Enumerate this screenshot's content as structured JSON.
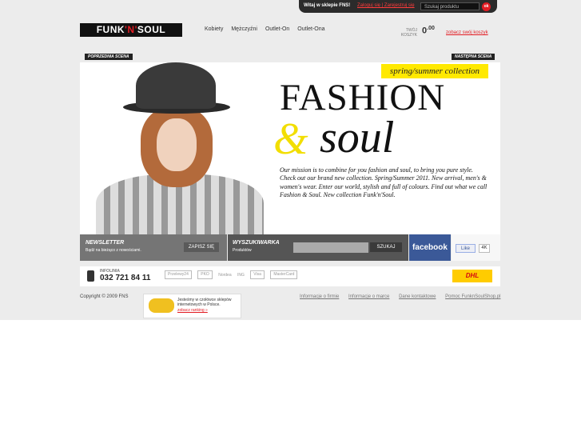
{
  "topbar": {
    "welcome": "Witaj w sklepie FNS!",
    "login": "Zaloguj się | Zarejestruj się",
    "search_placeholder": "Szukaj produktu",
    "search_button": "ok"
  },
  "logo": {
    "part1": "FUNK",
    "mid": "'N'",
    "part2": "SOUL"
  },
  "nav": [
    "Kobiety",
    "Mężczyźni",
    "Outlet-On",
    "Outlet-Ona"
  ],
  "cart": {
    "label": "TWÓJ KOSZYK",
    "amount": "0",
    "cents": ".00",
    "link": "zobacz swój koszyk"
  },
  "hero": {
    "prev": "POPRZEDNIA SCENA",
    "next": "NASTĘPNA SCENA",
    "season": "spring/summer collection",
    "headline": "FASHION",
    "amp": "&",
    "soul": "soul",
    "mission": "Our mission is to combine for you fashion and soul, to bring you pure style. Check out our brand new collection. Spring/Summer 2011. New arrival, men's & women's wear. Enter our world, stylish and full of colours. Find out what we call Fashion & Soul. New collection Funk'n'Soul."
  },
  "newsletter": {
    "title": "NEWSLETTER",
    "subtitle": "Bądź na bieżąco z nowościami.",
    "button": "ZAPISZ SIĘ"
  },
  "search": {
    "title": "WYSZUKIWARKA",
    "subtitle": "Produktów",
    "button": "SZUKAJ"
  },
  "facebook": {
    "label": "facebook",
    "like": "Like",
    "count": "4K"
  },
  "info": {
    "label": "INFOLINIA",
    "phone": "032 721 84 11"
  },
  "partners": [
    "Przelewy24",
    "PKO",
    "Nordea",
    "ING",
    "Visa",
    "MasterCard"
  ],
  "dhl": "DHL",
  "footer": {
    "copyright": "Copyright © 2009 FNS",
    "links": [
      "Informacje o firmie",
      "Informacje o marce",
      "Dane kontaktowe",
      "Pomoc FunknSoulShop.pl"
    ]
  },
  "badge": {
    "text": "Jesteśmy w czołówce sklepów internetowych w Polsce.",
    "link": "zobacz ranking »"
  }
}
